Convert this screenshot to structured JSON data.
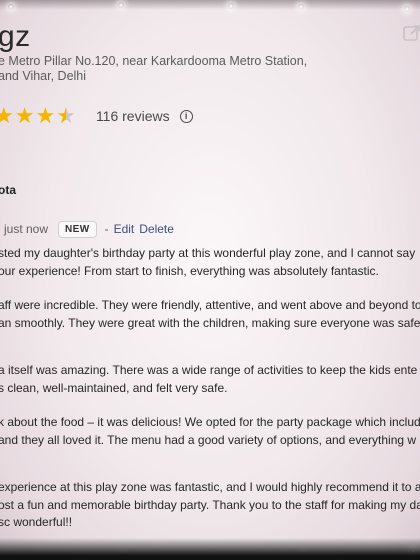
{
  "place": {
    "title": "gz",
    "address_lines": [
      "e Metro Pillar No.120, near Karkardooma Metro Station,",
      "and Vihar, Delhi"
    ]
  },
  "rating": {
    "stars": 4.5,
    "reviews_label": "116 reviews",
    "info_icon": "info-icon"
  },
  "review": {
    "reviewer": "ota",
    "time": "just now",
    "badge": "NEW",
    "separator": "-",
    "edit_label": "Edit",
    "delete_label": "Delete",
    "paragraphs": [
      [
        "sted my daughter's birthday party at this wonderful play zone, and I cannot say",
        "our experience! From start to finish, everything was absolutely fantastic."
      ],
      [
        "aff were incredible. They were friendly, attentive, and went above and beyond to",
        "an smoothly. They were great with the children, making sure everyone was safe"
      ],
      [
        "a itself was amazing. There was a wide range of activities to keep the kids ente",
        "s clean, well-maintained, and felt very safe."
      ],
      [
        "k about the food – it was delicious! We opted for the party package which include",
        "and they all loved it. The menu had a good variety of options, and everything w"
      ],
      [
        "experience at this play zone was fantastic, and I would highly recommend it to a",
        "ost a fun and memorable birthday party. Thank you to the staff for making my da",
        "sc wonderful!!"
      ]
    ]
  },
  "colors": {
    "star": "#f4b400",
    "link": "#3c4e8a",
    "background": "#f4eef0"
  }
}
